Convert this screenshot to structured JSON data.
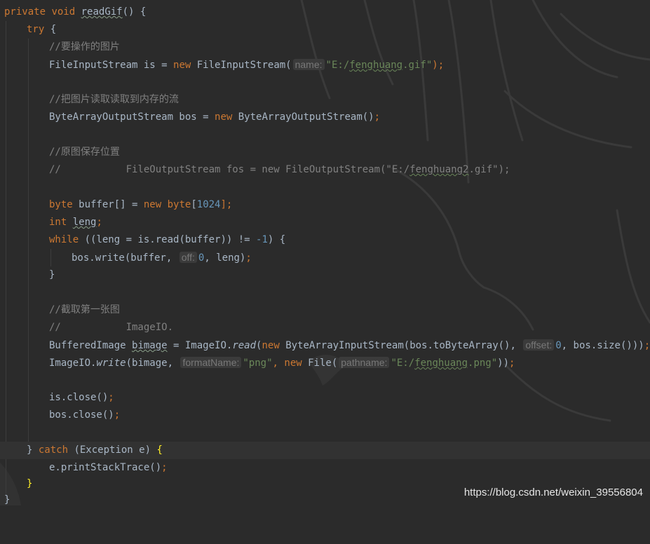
{
  "editor": {
    "lines": {
      "l1": {
        "t1": "private",
        "t2": "void",
        "t3": "readGif",
        "t4": "() {"
      },
      "l2": {
        "t1": "try",
        "t2": " {"
      },
      "l3": {
        "t1": "//要操作的图片"
      },
      "l4": {
        "t1": "FileInputStream is = ",
        "t2": "new",
        "t3": " FileInputStream(",
        "hint": "name:",
        "t4": "\"E:/",
        "t5": "fenghuang",
        "t6": ".gif\"",
        "t7": ");"
      },
      "l6": {
        "t1": "//把图片读取读取到内存的流"
      },
      "l7": {
        "t1": "ByteArrayOutputStream bos = ",
        "t2": "new",
        "t3": " ByteArrayOutputStream()",
        "t4": ";"
      },
      "l9": {
        "t1": "//原图保存位置"
      },
      "l10": {
        "t1": "//           FileOutputStream fos = new FileOutputStream(\"E:/",
        "t2": "fenghuang2",
        "t3": ".gif\");"
      },
      "l12": {
        "t1": "byte",
        "t2": " buffer[] = ",
        "t3": "new",
        "t4": " ",
        "t5": "byte",
        "t6": "[",
        "t7": "1024",
        "t8": "];"
      },
      "l13": {
        "t1": "int",
        "t2": " ",
        "t3": "leng",
        "t4": ";"
      },
      "l14": {
        "t1": "while",
        "t2": " ((leng = is.read(buffer)) != ",
        "t3": "-1",
        "t4": ") {"
      },
      "l15": {
        "t1": "bos.write(buffer, ",
        "hint": "off:",
        "t2": "0",
        "t3": ", leng)",
        "t4": ";"
      },
      "l16": {
        "t1": "}"
      },
      "l18": {
        "t1": "//截取第一张图"
      },
      "l19": {
        "t1": "//           ImageIO."
      },
      "l20": {
        "t1": "BufferedImage ",
        "t2": "bimage",
        "t3": " = ImageIO.",
        "t4": "read",
        "t5": "(",
        "t6": "new",
        "t7": " ByteArrayInputStream(bos.toByteArray(), ",
        "hint": "offset:",
        "t8": "0",
        "t9": ", bos.size()))",
        "t10": ";"
      },
      "l21": {
        "t1": "ImageIO.",
        "t2": "write",
        "t3": "(bimage, ",
        "hint1": "formatName:",
        "t4": "\"png\"",
        "t5": ", ",
        "t6": "new",
        "t7": " File(",
        "hint2": "pathname:",
        "t8": "\"E:/",
        "t9": "fenghuang",
        "t10": ".png\"",
        "t11": "))",
        "t12": ";"
      },
      "l23": {
        "t1": "is.close()",
        "t2": ";"
      },
      "l24": {
        "t1": "bos.close()",
        "t2": ";"
      },
      "l26": {
        "t1": "} ",
        "t2": "catch",
        "t3": " (Exception e) ",
        "t4": "{"
      },
      "l27": {
        "t1": "e.printStackTrace()",
        "t2": ";"
      },
      "l28": {
        "t1": "}"
      },
      "l29": {
        "t1": "}"
      }
    }
  },
  "watermark": "https://blog.csdn.net/weixin_39556804",
  "colors": {
    "background": "#2b2b2b",
    "keyword": "#cc7832",
    "number": "#6897bb",
    "string": "#6a8759",
    "comment": "#808080",
    "text": "#a9b7c6",
    "brace_highlight": "#ffef28"
  }
}
